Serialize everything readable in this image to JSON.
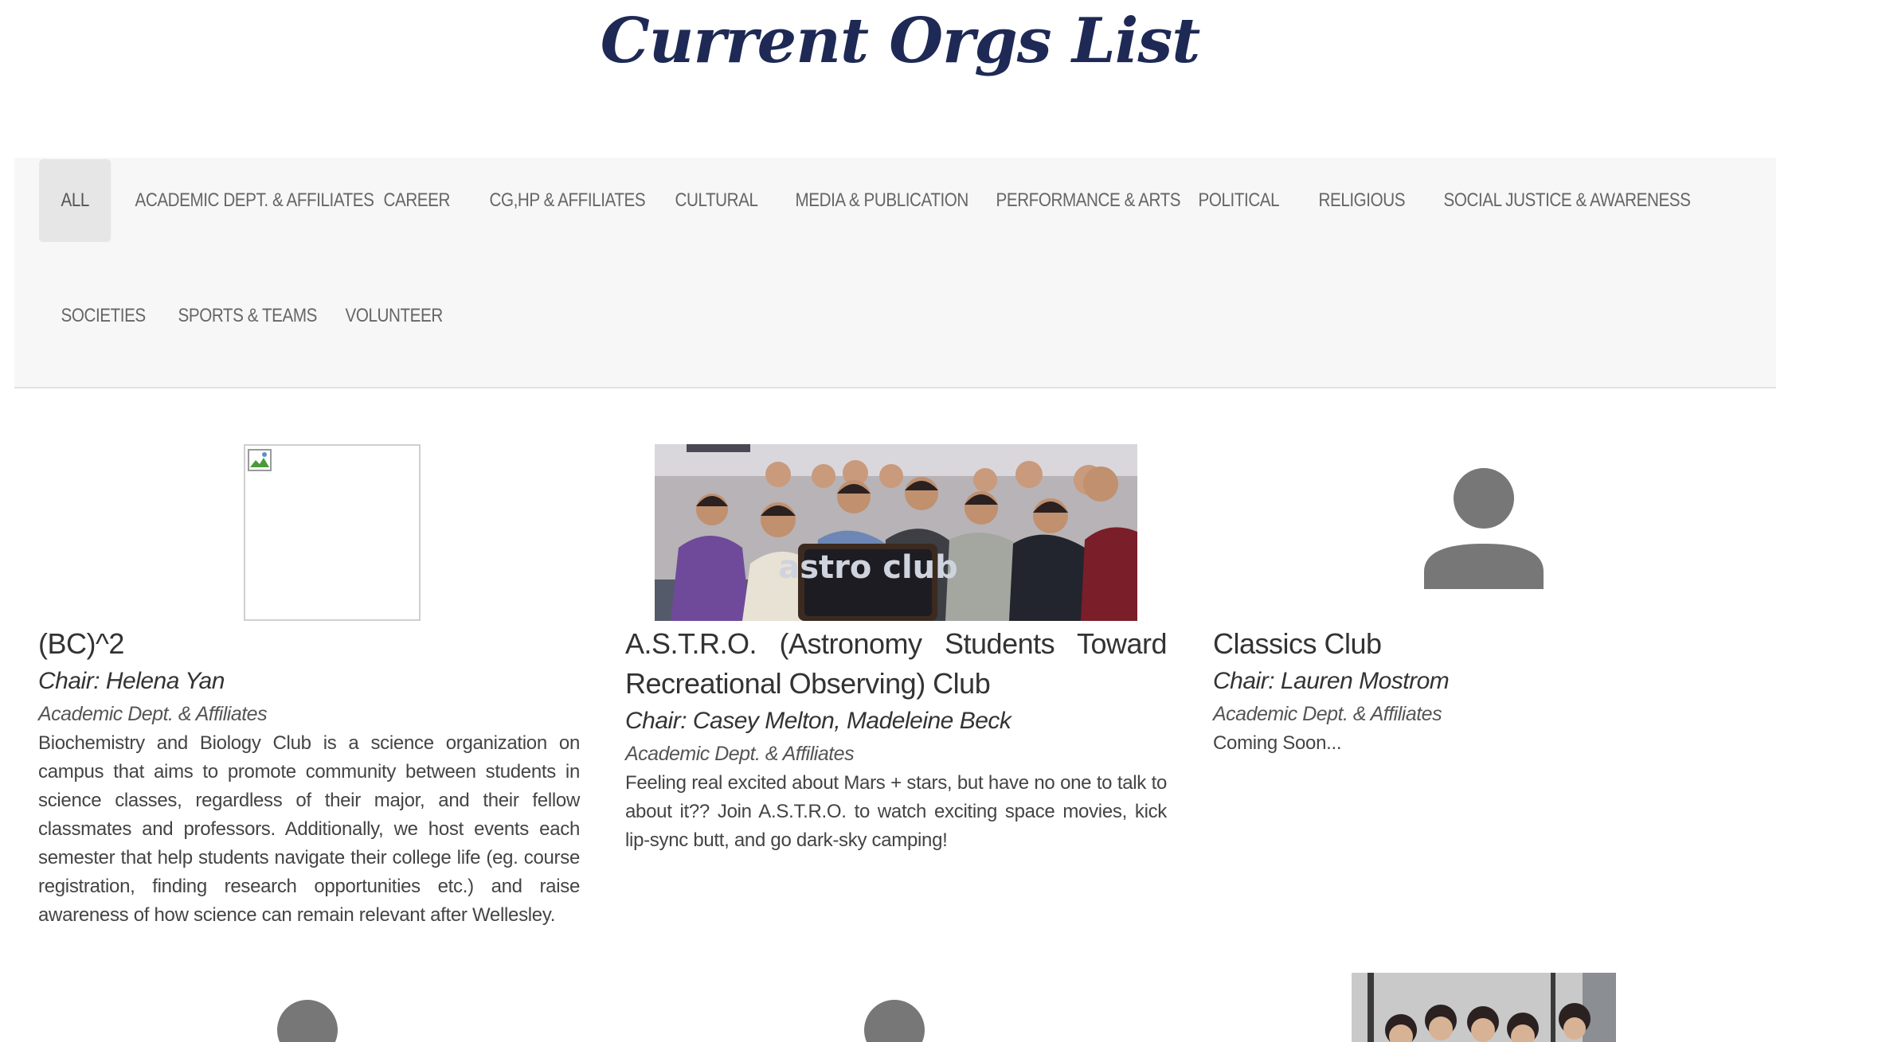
{
  "page_title": "Current Orgs List",
  "filters": [
    {
      "label": "ALL",
      "active": true
    },
    {
      "label": "ACADEMIC DEPT. & AFFILIATES"
    },
    {
      "label": "CAREER"
    },
    {
      "label": "CG,HP & AFFILIATES"
    },
    {
      "label": "CULTURAL"
    },
    {
      "label": "MEDIA & PUBLICATION"
    },
    {
      "label": "PERFORMANCE & ARTS"
    },
    {
      "label": "POLITICAL"
    },
    {
      "label": "RELIGIOUS"
    },
    {
      "label": "SOCIAL JUSTICE & AWARENESS"
    },
    {
      "label": "SOCIETIES"
    },
    {
      "label": "SPORTS & TEAMS"
    },
    {
      "label": "VOLUNTEER"
    }
  ],
  "orgs": [
    {
      "name": "(BC)^2",
      "chair": "Chair: Helena Yan",
      "category": "Academic Dept. & Affiliates",
      "description": "Biochemistry and Biology Club is a science organization on campus that aims to promote community between students in science classes, regardless of their major, and their fellow classmates and professors. Additionally, we host events each semester that help students navigate their college life (eg. course registration, finding research opportunities etc.) and raise awareness of how science can remain relevant after Wellesley.",
      "image": "broken-image"
    },
    {
      "name": "A.S.T.R.O. (Astronomy Students Toward Recreational Observing) Club",
      "chair": "Chair: Casey Melton, Madeleine Beck",
      "category": "Academic Dept. & Affiliates",
      "description": "Feeling real excited about Mars + stars, but have no one to talk to about it?? Join A.S.T.R.O. to watch exciting space movies, kick lip-sync butt, and go dark-sky camping!",
      "image": "group-photo",
      "sign_text": "astro club"
    },
    {
      "name": "Classics Club",
      "chair": "Chair: Lauren Mostrom",
      "category": "Academic Dept. & Affiliates",
      "description": "Coming Soon...",
      "image": "avatar-placeholder"
    }
  ],
  "colors": {
    "title": "#1e2a55",
    "filter_bg": "#f7f7f7",
    "filter_active_bg": "#e6e6e6",
    "avatar": "#777777"
  }
}
